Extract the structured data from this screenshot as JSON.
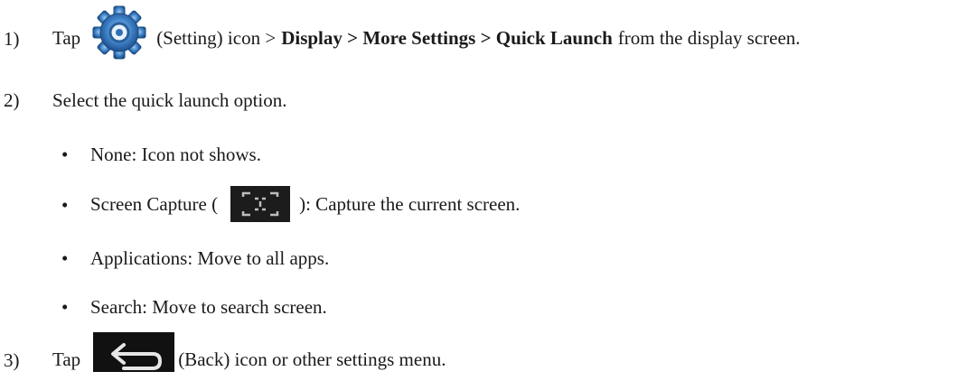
{
  "steps": [
    {
      "num": "1)",
      "tap": "Tap",
      "icon_label": "(Setting) icon >",
      "path": "Display > More Settings > Quick Launch",
      "suffix": "from the display screen.",
      "icon": "gear-icon"
    },
    {
      "num": "2)",
      "text": "Select the quick launch option."
    },
    {
      "num": "3)",
      "tap": "Tap",
      "icon_label": "(Back) icon or other settings menu.",
      "icon": "back-arrow-icon"
    }
  ],
  "options": [
    {
      "bullet": "•",
      "text": "None: Icon not shows."
    },
    {
      "bullet": "•",
      "prefix": "Screen Capture (",
      "suffix": "): Capture the current screen.",
      "icon": "screen-capture-icon"
    },
    {
      "bullet": "•",
      "text": "Applications: Move to all apps."
    },
    {
      "bullet": "•",
      "text": "Search: Move to search screen."
    }
  ],
  "colors": {
    "gear_blue": "#2f6fb5",
    "gear_light": "#7fb6e8",
    "icon_dark": "#1c1c1c",
    "back_bg": "#111111"
  }
}
